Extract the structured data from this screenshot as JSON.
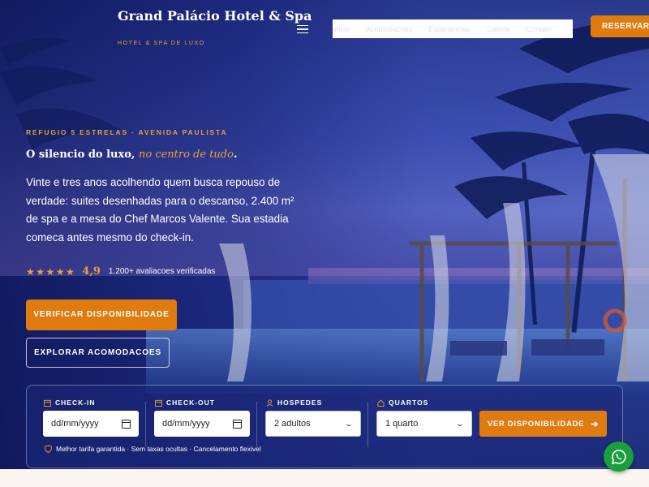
{
  "header": {
    "brand_name": "Grand Palácio Hotel & Spa",
    "brand_tagline": "HOTEL & SPA DE LUXO",
    "nav_items": [
      "Inicio",
      "Acomodacoes",
      "Experiencias",
      "Galeria",
      "Contato"
    ],
    "reserve_label": "RESERVAR AGORA"
  },
  "hero": {
    "eyebrow": "REFUGIO 5 ESTRELAS · AVENIDA PAULISTA",
    "headline_main": "O silencio do luxo, ",
    "headline_accent": "no centro de tudo",
    "headline_end": ".",
    "lead": "Vinte e tres anos acolhendo quem busca repouso de verdade: suites desenhadas para o descanso, 2.400 m² de spa e a mesa do Chef Marcos Valente. Sua estadia comeca antes mesmo do check-in.",
    "stars": "★★★★★",
    "rating_score": "4,9",
    "rating_count": "1.200+ avaliacoes verificadas",
    "primary_cta": "VERIFICAR DISPONIBILIDADE",
    "secondary_cta": "EXPLORAR ACOMODACOES"
  },
  "booking": {
    "checkin_label": "CHECK-IN",
    "checkin_placeholder": "dd/mm/yyyy",
    "checkout_label": "CHECK-OUT",
    "checkout_placeholder": "dd/mm/yyyy",
    "guests_label": "HOSPEDES",
    "guests_value": "2 adultos",
    "rooms_label": "QUARTOS",
    "rooms_value": "1 quarto",
    "search_label": "VER DISPONIBILIDADE",
    "notes": "Melhor tarifa garantida · Sem taxas ocultas · Cancelamento flexivel"
  },
  "colors": {
    "accent": "#e07b10",
    "gold": "#e8a13a",
    "whatsapp": "#1b9e3e"
  },
  "icons": {
    "menu": "hamburger-icon",
    "calendar": "calendar-icon",
    "guests": "user-icon",
    "rooms": "home-icon",
    "shield": "shield-icon",
    "arrow": "arrow-right-icon",
    "whatsapp": "whatsapp-icon"
  }
}
